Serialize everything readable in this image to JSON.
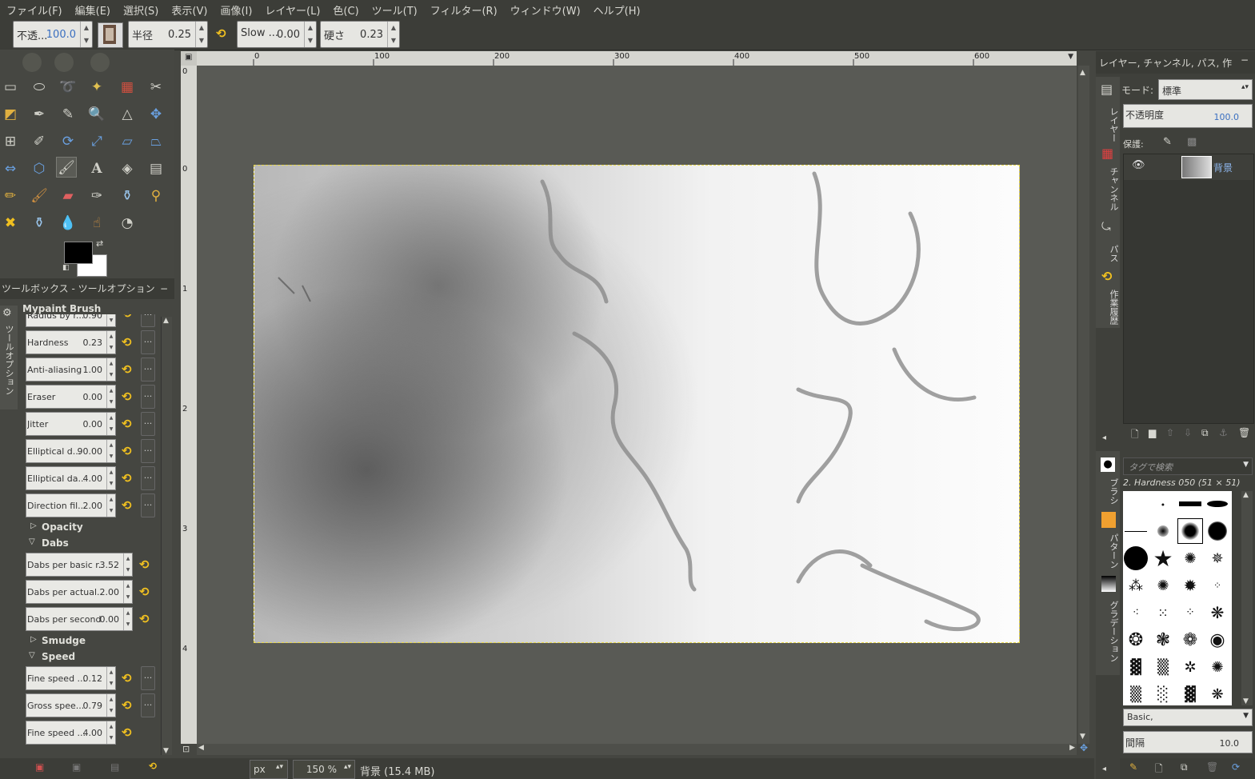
{
  "menubar": {
    "items": [
      "ファイル(F)",
      "編集(E)",
      "選択(S)",
      "表示(V)",
      "画像(I)",
      "レイヤー(L)",
      "色(C)",
      "ツール(T)",
      "フィルター(R)",
      "ウィンドウ(W)",
      "ヘルプ(H)"
    ]
  },
  "optbar": {
    "opacity": {
      "label": "不透...",
      "value": "100.0"
    },
    "radius": {
      "label": "半径",
      "value": "0.25"
    },
    "slow": {
      "label": "Slow ...",
      "value": "0.00"
    },
    "hardness": {
      "label": "硬さ",
      "value": "0.23"
    }
  },
  "toolbox": {
    "panel_title": "ツールボックス - ツールオプション",
    "vertical_tab": "ツールオプション",
    "tool_title": "Mypaint Brush",
    "rows_a": [
      {
        "label": "Radius by r...",
        "value": "0.90"
      },
      {
        "label": "Hardness",
        "value": "0.23"
      },
      {
        "label": "Anti-aliasing",
        "value": "1.00"
      },
      {
        "label": "Eraser",
        "value": "0.00"
      },
      {
        "label": "Jitter",
        "value": "0.00"
      },
      {
        "label": "Elliptical d...",
        "value": "90.00"
      },
      {
        "label": "Elliptical da...",
        "value": "4.00"
      },
      {
        "label": "Direction fil...",
        "value": "2.00"
      }
    ],
    "section_opacity": "Opacity",
    "section_dabs": "Dabs",
    "rows_dabs": [
      {
        "label": "Dabs per basic r...",
        "value": "3.52"
      },
      {
        "label": "Dabs per actual...",
        "value": "2.00"
      },
      {
        "label": "Dabs per second",
        "value": "0.00"
      }
    ],
    "section_smudge": "Smudge",
    "section_speed": "Speed",
    "rows_speed": [
      {
        "label": "Fine speed ...",
        "value": "0.12"
      },
      {
        "label": "Gross spee...",
        "value": "0.79"
      },
      {
        "label": "Fine speed ...",
        "value": "4.00"
      }
    ],
    "more_label": "..."
  },
  "rulers": {
    "top": [
      "0",
      "100",
      "200",
      "300",
      "400",
      "500",
      "600"
    ],
    "left": [
      "0",
      "0",
      "1",
      "2",
      "3",
      "4"
    ]
  },
  "status": {
    "unit": "px",
    "zoom": "150 %",
    "info": "背景 (15.4 MB)"
  },
  "layers": {
    "title": "レイヤー, チャンネル, パス, 作",
    "mode_label": "モード:",
    "mode_value": "標準",
    "opacity_label": "不透明度",
    "opacity_value": "100.0",
    "lock_label": "保護:",
    "layer_name": "背景",
    "vtabs": [
      "レイヤー",
      "チャンネル",
      "パス",
      "作業履歴"
    ]
  },
  "brushes": {
    "filter_placeholder": "タグで検索",
    "selected_name": "2. Hardness 050 (51 × 51)",
    "preset": "Basic,",
    "spacing_label": "間隔",
    "spacing_value": "10.0",
    "vtabs": [
      "ブラシ",
      "パターン",
      "グラデーション"
    ]
  }
}
